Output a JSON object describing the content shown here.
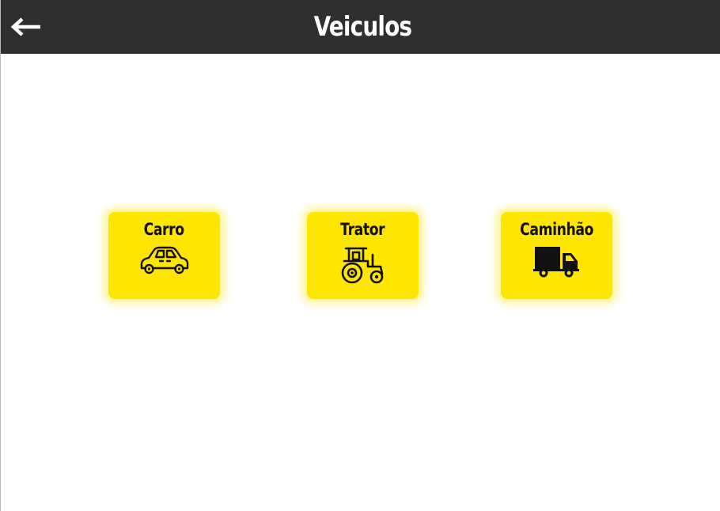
{
  "header": {
    "title": "Veiculos",
    "back_icon": "arrow-left-icon"
  },
  "vehicles": [
    {
      "label": "Carro",
      "icon": "car-icon"
    },
    {
      "label": "Trator",
      "icon": "tractor-icon"
    },
    {
      "label": "Caminhão",
      "icon": "truck-icon"
    }
  ],
  "colors": {
    "header_bg": "#2f2f2f",
    "tile_bg": "#ffe600",
    "page_bg": "#ffffff",
    "title_text": "#ffffff",
    "tile_text": "#111111"
  }
}
